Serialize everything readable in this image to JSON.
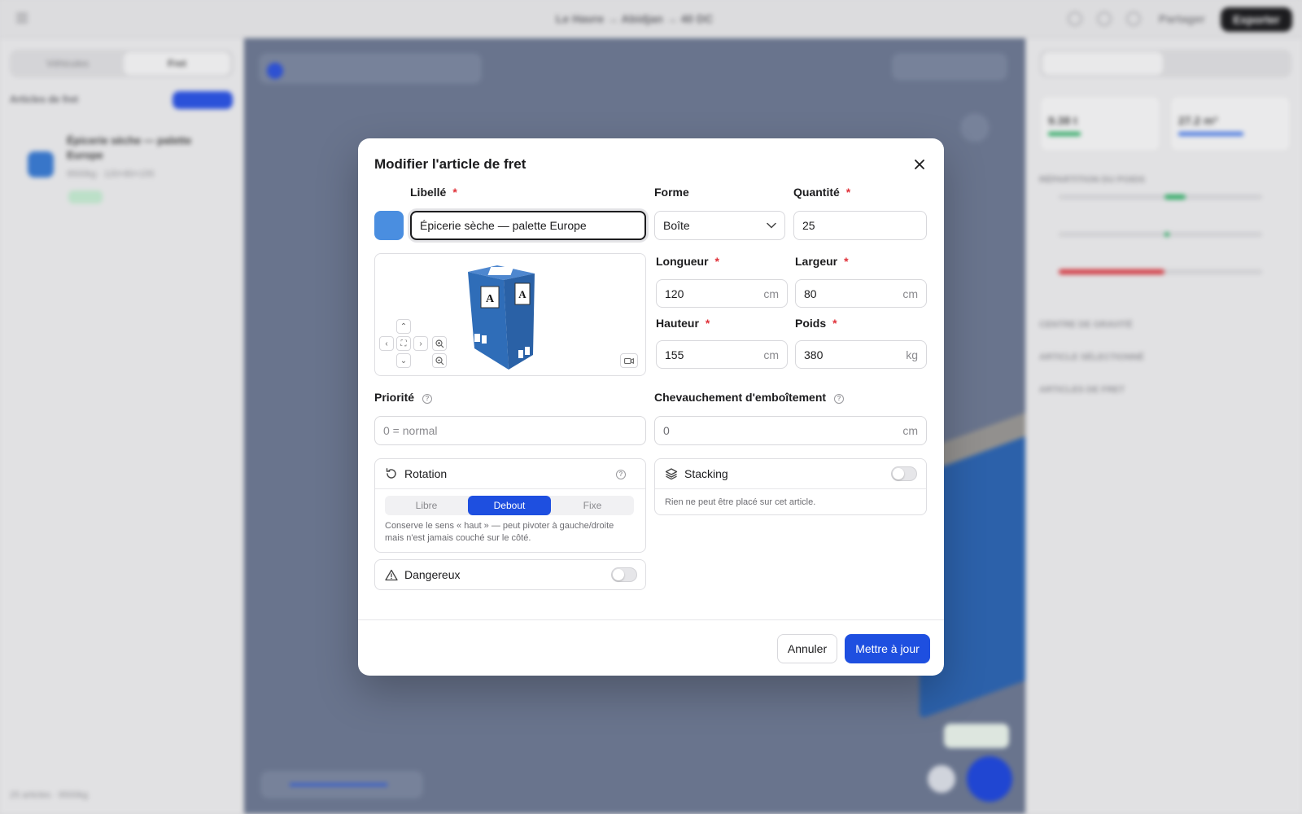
{
  "modal": {
    "title": "Modifier l'article de fret",
    "labels": {
      "libelle": "Libellé",
      "forme": "Forme",
      "quantite": "Quantité",
      "longueur": "Longueur",
      "largeur": "Largeur",
      "hauteur": "Hauteur",
      "poids": "Poids",
      "priorite": "Priorité",
      "chevauchement": "Chevauchement d'emboîtement"
    },
    "required_mark": "*",
    "values": {
      "libelle": "Épicerie sèche — palette Europe",
      "forme": "Boîte",
      "quantite": "25",
      "longueur": "120",
      "largeur": "80",
      "hauteur": "155",
      "poids": "380",
      "chevauchement": "0"
    },
    "units": {
      "cm": "cm",
      "kg": "kg"
    },
    "placeholders": {
      "priorite": "0 = normal"
    },
    "swatch_color": "#4a8ee0",
    "preview": {
      "face_letter": "A",
      "cube_color": "#2f6db8"
    },
    "rotation": {
      "title": "Rotation",
      "options": [
        "Libre",
        "Debout",
        "Fixe"
      ],
      "selected": "Debout",
      "hint": "Conserve le sens « haut » — peut pivoter à gauche/droite mais n'est jamais couché sur le côté."
    },
    "stacking": {
      "title": "Stacking",
      "enabled": false,
      "hint": "Rien ne peut être placé sur cet article."
    },
    "dangereux": {
      "title": "Dangereux",
      "enabled": false
    },
    "buttons": {
      "cancel": "Annuler",
      "save": "Mettre à jour"
    },
    "accent_color": "#1e4fe0"
  }
}
